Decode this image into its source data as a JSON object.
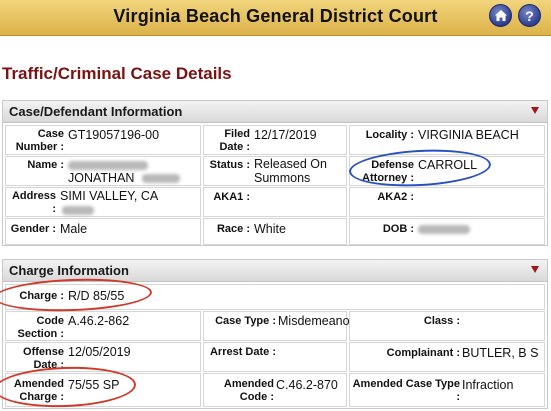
{
  "header": {
    "title": "Virginia Beach General District Court",
    "home_icon": "home-icon",
    "help_icon": "help-icon",
    "help_glyph": "?"
  },
  "page_title": "Traffic/Criminal Case Details",
  "case_section": {
    "heading": "Case/Defendant Information",
    "case_number_label": "Case Number :",
    "case_number": "GT19057196-00",
    "filed_date_label": "Filed Date :",
    "filed_date": "12/17/2019",
    "locality_label": "Locality :",
    "locality": "VIRGINIA BEACH",
    "name_label": "Name :",
    "name_visible": "JONATHAN",
    "status_label": "Status :",
    "status": "Released On Summons",
    "defense_attorney_label": "Defense Attorney :",
    "defense_attorney": "CARROLL",
    "address_label": "Address :",
    "address": "SIMI VALLEY, CA",
    "aka1_label": "AKA1 :",
    "aka2_label": "AKA2 :",
    "gender_label": "Gender :",
    "gender": "Male",
    "race_label": "Race :",
    "race": "White",
    "dob_label": "DOB :"
  },
  "charge_section": {
    "heading": "Charge Information",
    "charge_label": "Charge :",
    "charge": "R/D 85/55",
    "code_section_label": "Code Section :",
    "code_section": "A.46.2-862",
    "case_type_label": "Case Type :",
    "case_type": "Misdemeanor",
    "class_label": "Class :",
    "offense_date_label": "Offense Date :",
    "offense_date": "12/05/2019",
    "arrest_date_label": "Arrest Date :",
    "complainant_label": "Complainant :",
    "complainant": "BUTLER, B S",
    "amended_charge_label": "Amended Charge :",
    "amended_charge": "75/55 SP",
    "amended_code_label": "Amended Code :",
    "amended_code": "C.46.2-870",
    "amended_case_type_label": "Amended Case Type :",
    "amended_case_type": "Infraction"
  },
  "colors": {
    "header_gold": "#dcb24a",
    "title_maroon": "#7b1212",
    "toggle_red": "#a3141c",
    "annotation_red": "#d03a2a",
    "annotation_blue": "#2a4fc0"
  }
}
